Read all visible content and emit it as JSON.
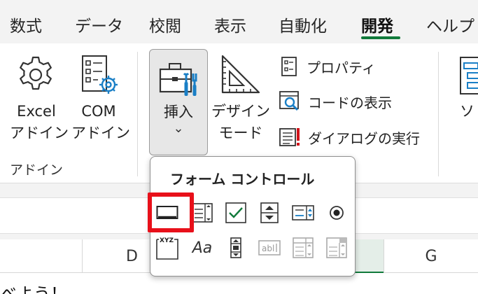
{
  "tabs": [
    {
      "label": "数式",
      "active": false
    },
    {
      "label": "データ",
      "active": false
    },
    {
      "label": "校閲",
      "active": false
    },
    {
      "label": "表示",
      "active": false
    },
    {
      "label": "自動化",
      "active": false
    },
    {
      "label": "開発",
      "active": true
    },
    {
      "label": "ヘルプ",
      "active": false
    }
  ],
  "ribbon": {
    "addins": {
      "excel_line1": "Excel",
      "excel_line2": "アドイン",
      "com_line1": "COM",
      "com_line2": "アドイン",
      "group_label": "アドイン"
    },
    "controls": {
      "insert_label": "挿入",
      "insert_chevron": "⌄",
      "design_line1": "デザイン",
      "design_line2": "モード",
      "properties_label": "プロパティ",
      "view_code_label": "コードの表示",
      "run_dialog_label": "ダイアログの実行"
    },
    "next_group_partial": "ソ"
  },
  "dropdown": {
    "title": "フォーム コントロール",
    "label_control_text": "Aa",
    "groupbox_text": "XYZ",
    "textfield_text": "abl"
  },
  "sheet": {
    "columns": [
      "D",
      "",
      "G"
    ],
    "cell_text": "べよう！"
  },
  "colors": {
    "accent": "#117a3b",
    "highlight": "#e8101a",
    "icon_blue": "#1a7fc6"
  }
}
